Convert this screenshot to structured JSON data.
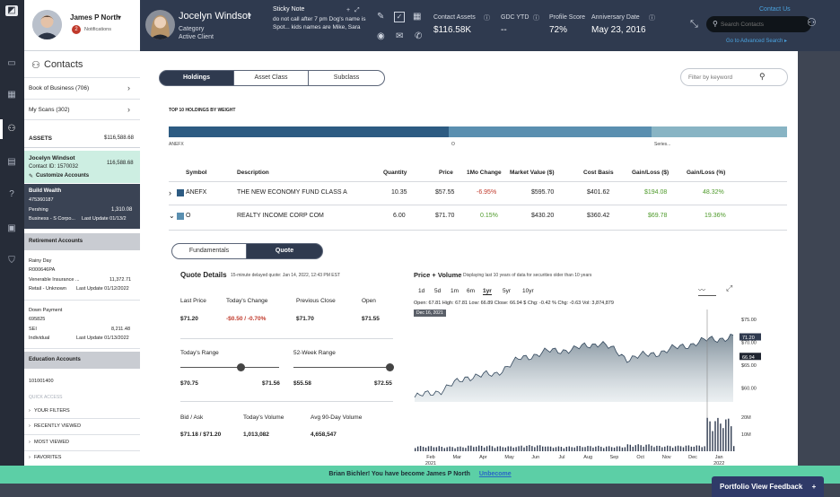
{
  "user": {
    "name": "James P North",
    "notifications_label": "Notifications",
    "notification_count": "2"
  },
  "client": {
    "name": "Jocelyn Windsot",
    "category_label": "Category",
    "category_value": "Active Client"
  },
  "sticky_note": {
    "title": "Sticky Note",
    "text": "do not call after 7 pm Dog's name is Spot... kids names are Mike, Sara"
  },
  "metrics": {
    "contact_assets_label": "Contact Assets",
    "contact_assets_value": "$116.58K",
    "gdc_ytd_label": "GDC YTD",
    "gdc_ytd_value": "--",
    "profile_score_label": "Profile Score",
    "profile_score_value": "72%",
    "anniversary_label": "Anniversary Date",
    "anniversary_value": "May 23, 2016"
  },
  "header": {
    "contact_us": "Contact Us",
    "search_placeholder": "Search Contacts",
    "advanced_search": "Go to Advanced Search ▸"
  },
  "sidebar": {
    "title": "Contacts",
    "book_of_business": "Book of Business (706)",
    "my_scans": "My Scans (302)",
    "assets_label": "ASSETS",
    "assets_value": "$116,588.68",
    "contact_name": "Jocelyn Windsot",
    "contact_id": "Contact ID: 1570032",
    "contact_value": "116,588.68",
    "customize_accounts": "Customize Accounts",
    "build_wealth": {
      "title": "Build Wealth",
      "number": "475360187",
      "custodian": "Pershing",
      "value": "1,310.08",
      "type": "Business - S Corpo...",
      "last_update": "Last Update 01/13/2"
    },
    "retirement_header": "Retirement Accounts",
    "rainy_day": {
      "title": "Rainy Day",
      "number": "R000646PA",
      "custodian": "Venerable Insurance ...",
      "value": "11,372.71",
      "type": "Retail - Unknown",
      "last_update": "Last Update 01/12/2022"
    },
    "down_payment": {
      "title": "Down Payment",
      "number": "695825",
      "custodian": "SEI",
      "value": "8,211.48",
      "type": "Individual",
      "last_update": "Last Update 01/13/2022"
    },
    "education_header": "Education Accounts",
    "education_number": "101001400",
    "quick_access": "QUICK ACCESS",
    "quick_items": [
      "YOUR FILTERS",
      "RECENTLY VIEWED",
      "MOST VIEWED",
      "FAVORITES"
    ]
  },
  "main": {
    "tabs": [
      "Holdings",
      "Asset Class",
      "Subclass"
    ],
    "filter_placeholder": "Filter by keyword",
    "top10_label": "TOP 10 HOLDINGS BY WEIGHT",
    "weight_labels": [
      "ANEFX",
      "O",
      "Series..."
    ],
    "columns": [
      "Symbol",
      "Description",
      "Quantity",
      "Price",
      "1Mo Change",
      "Market Value ($)",
      "Cost Basis",
      "Gain/Loss ($)",
      "Gain/Loss (%)"
    ],
    "rows": [
      {
        "symbol": "ANEFX",
        "description": "THE NEW ECONOMY FUND CLASS A",
        "quantity": "10.35",
        "price": "$57.55",
        "change": "-6.95%",
        "market_value": "$595.70",
        "cost_basis": "$401.62",
        "gain_loss": "$194.08",
        "gain_loss_pct": "48.32%"
      },
      {
        "symbol": "O",
        "description": "REALTY INCOME CORP COM",
        "quantity": "6.00",
        "price": "$71.70",
        "change": "0.15%",
        "market_value": "$430.20",
        "cost_basis": "$360.42",
        "gain_loss": "$69.78",
        "gain_loss_pct": "19.36%"
      }
    ],
    "subtabs": [
      "Fundamentals",
      "Quote"
    ]
  },
  "quote": {
    "title": "Quote Details",
    "subtitle": "15-minute delayed quote: Jan 14, 2022, 12:43 PM EST",
    "last_price_label": "Last Price",
    "last_price": "$71.20",
    "todays_change_label": "Today's Change",
    "todays_change": "-$0.50 / -0.70%",
    "previous_close_label": "Previous Close",
    "previous_close": "$71.70",
    "open_label": "Open",
    "open": "$71.55",
    "todays_range_label": "Today's Range",
    "todays_range_low": "$70.75",
    "todays_range_high": "$71.56",
    "week52_label": "52-Week Range",
    "week52_low": "$55.58",
    "week52_high": "$72.55",
    "bid_ask_label": "Bid / Ask",
    "bid_ask": "$71.18 / $71.20",
    "volume_label": "Today's Volume",
    "volume": "1,013,082",
    "avg_volume_label": "Avg 90-Day Volume",
    "avg_volume": "4,658,547"
  },
  "price_volume": {
    "title": "Price + Volume",
    "subtitle": "Displaying last 10 years of data for securities older than 10 years",
    "ranges": [
      "1d",
      "5d",
      "1m",
      "6m",
      "1yr",
      "5yr",
      "10yr"
    ],
    "selected_range": "1yr",
    "ohlc": "Open: 67.81  High: 67.81  Low: 66.89  Close: 66.94  $ Chg: -0.42  % Chg: -0.63  Vol: 3,874,879",
    "crosshair_date": "Dec 16, 2021",
    "price_badge_1": "71.20",
    "price_badge_2": "66.94"
  },
  "chart_data": {
    "type": "area",
    "x": [
      "Jan 2021",
      "Feb 2021",
      "Mar 2021",
      "Apr 2021",
      "May 2021",
      "Jun 2021",
      "Jul 2021",
      "Aug 2021",
      "Sep 2021",
      "Oct 2021",
      "Nov 2021",
      "Dec 2021",
      "Jan 2022"
    ],
    "x_tick_labels": [
      "Feb\n2021",
      "Mar",
      "Apr",
      "May",
      "Jun",
      "Jul",
      "Aug",
      "Sep",
      "Oct",
      "Nov",
      "Dec",
      "Jan\n2022"
    ],
    "price_series": [
      58.0,
      59.5,
      62.5,
      63.0,
      66.5,
      68.0,
      68.5,
      70.0,
      66.5,
      67.5,
      69.0,
      70.5,
      71.2
    ],
    "volume_series": [
      3.1,
      2.8,
      3.4,
      3.0,
      3.6,
      2.9,
      3.2,
      3.0,
      4.1,
      3.3,
      3.5,
      19.5,
      3.9
    ],
    "y_ticks": [
      "$75.00",
      "$70.00",
      "$65.00",
      "$60.00"
    ],
    "volume_ticks": [
      "20M",
      "10M"
    ],
    "ylim": [
      57,
      76
    ]
  }
}
